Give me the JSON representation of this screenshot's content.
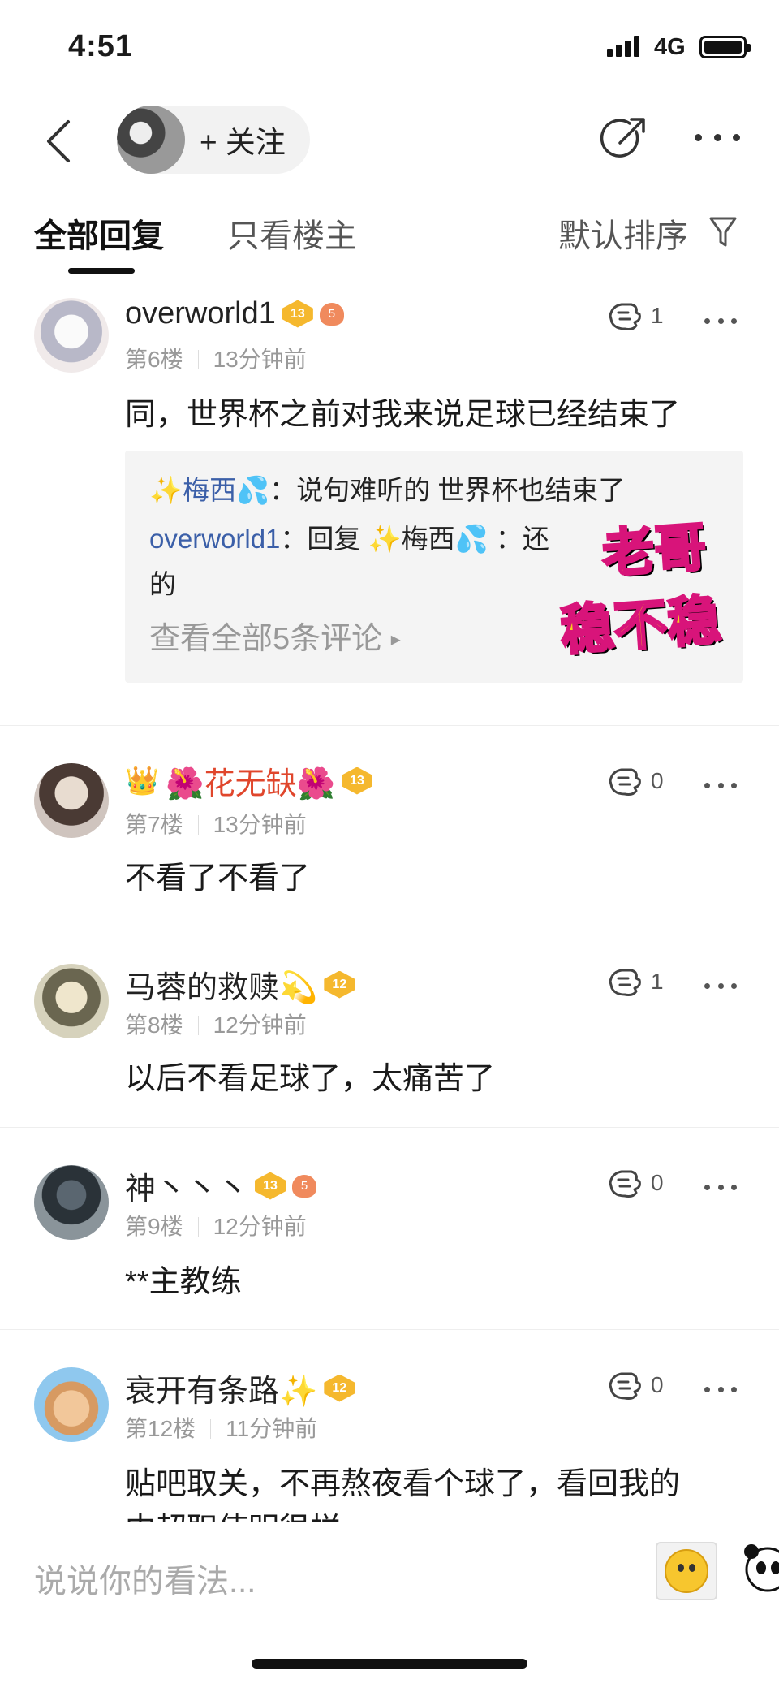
{
  "status_bar": {
    "time": "4:51",
    "network": "4G"
  },
  "nav": {
    "follow_label": "+ 关注"
  },
  "tabs": {
    "all_replies": "全部回复",
    "only_op": "只看楼主",
    "sort": "默认排序"
  },
  "comments": [
    {
      "name": "overworld1",
      "badge": "13",
      "mini_badge": "5",
      "floor": "第6楼",
      "time": "13分钟前",
      "text": "同，世界杯之前对我来说足球已经结束了",
      "likes": "1",
      "replies": [
        {
          "user": "✨梅西💦",
          "text": "：说句难听的 世界杯也结束了"
        },
        {
          "user": "overworld1",
          "text": "：回复 ✨梅西💦 ：还",
          "cont": "的"
        }
      ],
      "view_all": "查看全部5条评论",
      "sticker_top": "老哥",
      "sticker_bottom": "稳不稳"
    },
    {
      "name": "🌺花无缺🌺",
      "prefix_emoji": "👑",
      "badge": "13",
      "floor": "第7楼",
      "time": "13分钟前",
      "text": "不看了不看了",
      "likes": "0"
    },
    {
      "name": "马蓉的救赎💫",
      "badge": "12",
      "floor": "第8楼",
      "time": "12分钟前",
      "text": "以后不看足球了，太痛苦了",
      "likes": "1"
    },
    {
      "name": "神丶丶丶",
      "badge": "13",
      "mini_badge": "5",
      "floor": "第9楼",
      "time": "12分钟前",
      "text": "**主教练",
      "likes": "0"
    },
    {
      "name": "衰开有条路✨",
      "badge": "12",
      "floor": "第12楼",
      "time": "11分钟前",
      "text": "贴吧取关，不再熬夜看个球了，看回我的",
      "text_cont": "中超职使明很样",
      "likes": "0"
    }
  ],
  "input": {
    "placeholder": "说说你的看法..."
  },
  "icons": {
    "back": "back-arrow-icon",
    "share": "share-icon",
    "more": "more-icon",
    "filter": "filter-icon",
    "like": "like-hand-icon"
  }
}
